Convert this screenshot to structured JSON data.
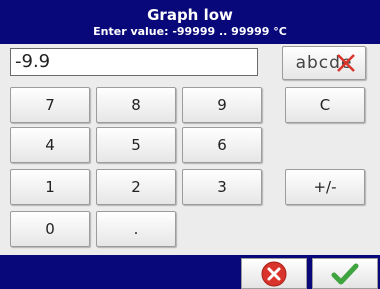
{
  "header": {
    "title": "Graph low",
    "subtitle": "Enter value: -99999 .. 99999 °C"
  },
  "input": {
    "value": "-9.9"
  },
  "keypad": {
    "k7": "7",
    "k8": "8",
    "k9": "9",
    "clear": "C",
    "k4": "4",
    "k5": "5",
    "k6": "6",
    "k1": "1",
    "k2": "2",
    "k3": "3",
    "sign": "+/-",
    "k0": "0",
    "dot": ".",
    "alpha": "abcde"
  },
  "footer": {
    "cancel_icon": "red-x-circle-icon",
    "ok_icon": "green-check-icon"
  },
  "colors": {
    "bar": "#08087a",
    "cancel": "#d9342b",
    "ok": "#3fa33f"
  }
}
